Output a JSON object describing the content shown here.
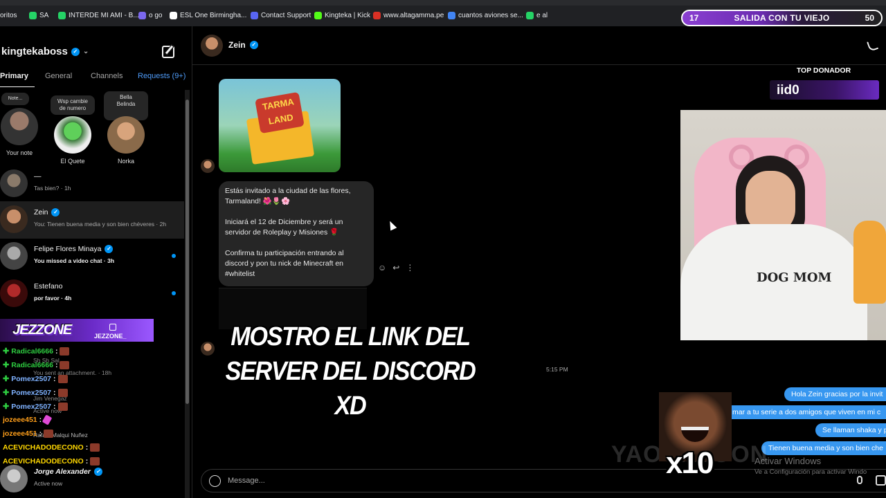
{
  "browser": {
    "bookmarks": [
      {
        "label": "oritos",
        "color": "#00000000"
      },
      {
        "label": "SA",
        "color": "#25d366"
      },
      {
        "label": "INTERDE MI AMI - B...",
        "color": "#25d366"
      },
      {
        "label": "o go",
        "color": "#7b68ee"
      },
      {
        "label": "ESL One Birmingha...",
        "color": "#ffffff"
      },
      {
        "label": "Contact Support",
        "color": "#5865f2"
      },
      {
        "label": "Kingteka | Kick",
        "color": "#53fc18"
      },
      {
        "label": "www.altagamma.pe",
        "color": "#d93025"
      },
      {
        "label": "cuantos aviones se...",
        "color": "#4285f4"
      },
      {
        "label": "e al",
        "color": "#25d366"
      }
    ]
  },
  "stream_goal": {
    "left_number": "17",
    "title": "SALIDA CON TU VIEJO",
    "right_number": "50"
  },
  "sidebar": {
    "username": "kingtekaboss",
    "tabs": {
      "primary": "Primary",
      "general": "General",
      "channels": "Channels",
      "requests": "Requests (9+)"
    },
    "notes": [
      {
        "bubble": "Note...",
        "name": "Your note"
      },
      {
        "bubble": "Wsp cambie de numero",
        "name": "El Quete"
      },
      {
        "bubble": "Bella\nBelinda",
        "name": "Norka"
      }
    ],
    "conversations": [
      {
        "name": "—",
        "preview": "Tas bien? · 1h",
        "unread": false
      },
      {
        "name": "Zein",
        "preview": "You: Tienen buena media y son bien chéveres · 2h",
        "unread": false
      },
      {
        "name": "Felipe Flores Minaya",
        "preview": "You missed a video chat · 3h",
        "unread": true
      },
      {
        "name": "Estefano",
        "preview": "por favor · 4h",
        "unread": true
      }
    ],
    "hidden_rows": {
      "row1_name": "Sh Sh Sal",
      "row1_preview": "You sent an attachment. · 18h",
      "row2_name": "Jim Venegaz",
      "row2_preview": "Active now",
      "row3_name": "Rafael Malqui Nuñez",
      "last_name": "Jorge Alexander",
      "last_preview": "Active now"
    }
  },
  "twitch_chat": {
    "logo": "JEZZONE",
    "handle": "JEZZONE_",
    "lines": [
      {
        "user": "Radical6666",
        "color": "#2ecc40",
        "plus": true
      },
      {
        "user": "Radical6666",
        "color": "#2ecc40",
        "plus": true
      },
      {
        "user": "Pomex2507",
        "color": "#7fb2ff",
        "plus": true
      },
      {
        "user": "Pomex2507",
        "color": "#7fb2ff",
        "plus": true
      },
      {
        "user": "Pomex2507",
        "color": "#7fb2ff",
        "plus": true
      },
      {
        "user": "jozeee451",
        "color": "#ff9f1a",
        "plus": false
      },
      {
        "user": "jozeee451",
        "color": "#ff9f1a",
        "plus": false
      },
      {
        "user": "ACEVICHADODECONO",
        "color": "#ffd700",
        "plus": false
      },
      {
        "user": "ACEVICHADODECONO",
        "color": "#ffd700",
        "plus": false
      }
    ]
  },
  "chat": {
    "contact_name": "Zein",
    "image_caption": "TARMA LAND",
    "message_paragraphs": [
      "Estás invitado a la ciudad de las flores, Tarmaland! 🌺🌷🌸",
      "Iniciará el 12 de Diciembre y será un servidor de Roleplay y Misiones 🌹",
      "Confirma tu participación entrando al discord y pon tu nick de Minecraft en #whitelist"
    ],
    "timestamp": "5:15 PM",
    "outgoing": [
      "Hola Zein gracias por la invit",
      "mar a tu serie a dos amigos que viven en mi c",
      "Se llaman shaka y p",
      "Tienen buena media y son bien che"
    ],
    "composer_placeholder": "Message..."
  },
  "overlays": {
    "caption": "MOSTRO EL LINK DEL SERVER DEL DISCORD XD",
    "top_donor_label": "TOP DONADOR",
    "top_donor_name": "iid0",
    "shirt_text": "DOG MOM",
    "meme_multiplier": "x10",
    "watermark": "YAOURTOON",
    "windows_activate_title": "Activar Windows",
    "windows_activate_sub": "Ve a Configuración para activar Windo"
  }
}
